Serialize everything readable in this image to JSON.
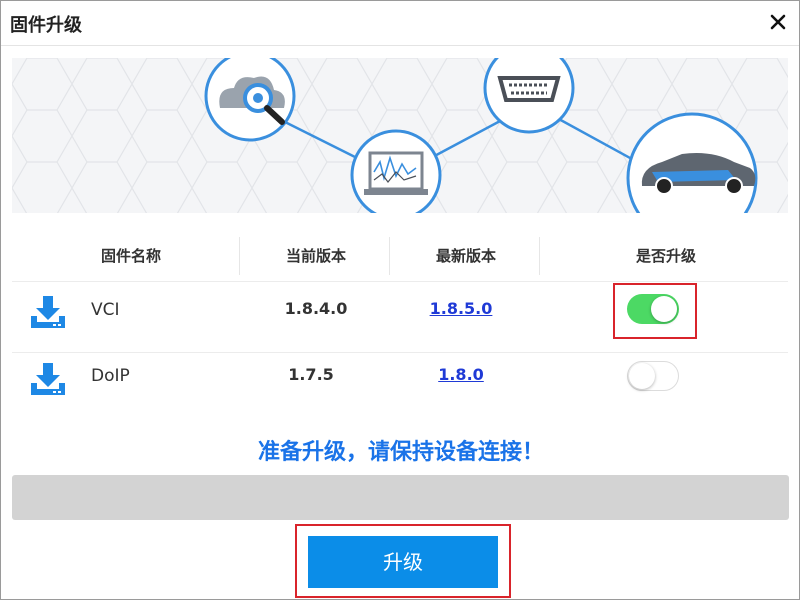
{
  "window": {
    "title": "固件升级"
  },
  "table": {
    "headers": [
      "固件名称",
      "当前版本",
      "最新版本",
      "是否升级"
    ],
    "rows": [
      {
        "name": "VCI",
        "current": "1.8.4.0",
        "latest": "1.8.5.0",
        "upgrade": true
      },
      {
        "name": "DoIP",
        "current": "1.7.5",
        "latest": "1.8.0",
        "upgrade": false
      }
    ]
  },
  "status_message": "准备升级，请保持设备连接！",
  "progress": 0,
  "upgrade_button": "升级",
  "colors": {
    "accent": "#0b8de8",
    "toggle_on": "#4cd964",
    "link": "#1f3ad6",
    "status": "#1a73e8",
    "highlight": "#d9242b"
  },
  "icons": [
    "close-icon",
    "cloud-search-icon",
    "oscilloscope-icon",
    "obd-connector-icon",
    "car-icon",
    "download-icon"
  ]
}
